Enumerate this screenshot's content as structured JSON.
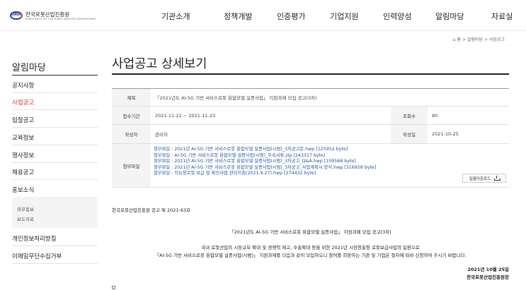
{
  "header": {
    "logo_text": "한국로봇산업진흥원",
    "logo_mark": "KIRIA",
    "logo_sub": "KOREA INSTITUTE FOR ROBOT INDUSTRY ADVANCEMENT",
    "nav": [
      "기관소개",
      "정책개발",
      "인증평가",
      "기업지원",
      "인력양성",
      "알림마당",
      "자료실"
    ]
  },
  "breadcrumb": {
    "home_icon": "home-icon",
    "home": "홈",
    "sep": ">",
    "level1": "알림마당",
    "level2": "사업공고"
  },
  "sidebar": {
    "title": "알림마당",
    "items": [
      {
        "label": "공지사항",
        "active": false
      },
      {
        "label": "사업공고",
        "active": true
      },
      {
        "label": "입찰공고",
        "active": false
      },
      {
        "label": "교육정보",
        "active": false
      },
      {
        "label": "행사정보",
        "active": false
      },
      {
        "label": "채용공고",
        "active": false
      },
      {
        "label": "홍보소식",
        "active": false
      }
    ],
    "subitems": [
      "외부홍보",
      "보도자료"
    ],
    "items_after": [
      "개인정보처리방침",
      "이메일무단수집거부"
    ]
  },
  "main": {
    "page_title": "사업공고 상세보기",
    "table": {
      "title_label": "제목",
      "title_value": "「2021년도 AI-5G 기반 서비스로봇 융합모델 실증사업」 지원과제 모집 공고(3차)",
      "period_label": "접수기간",
      "period_value": "2021-11-22 ~ 2021-11-23",
      "views_label": "조회수",
      "views_value": "80",
      "author_label": "작성자",
      "author_value": "관리자",
      "date_label": "작성일",
      "date_value": "2021-10-25",
      "files_label": "첨부파일",
      "files": [
        "첨부파일 : 2021년 AI-5G 기반 서비스로봇 융합모델 실증사업(시범)_3차공고문.hwp [125952 byte]",
        "첨부파일 : AI-5G 기반 서비스로봇 융합모델 실증사업(시범)_부속서류.zip [243317 byte]",
        "첨부파일 : 2021년 AI-5G 기반 서비스로봇 융합모델 실증사업(시범)_3차공고_Q&A.hwp [109568 byte]",
        "첨부파일 : 2021년 AI-5G 기반 서비스로봇 융합모델 실증사업(시범)_3차공고_사업계획서 양식.hwp [316928 byte]",
        "첨부파일 : 지능형로봇 보급 및 확산사업 관리지침(2021.9.27).hwp [274432 byte]"
      ],
      "download_all": "일괄다운로드"
    },
    "notice_no": "한국로봇산업진흥원 공고 제 2021-63호",
    "notice_title": "「2021년도 AI-5G 기반 서비스로봇 융합모델 실증사업」 지원과제 모집 공고(3차)",
    "paragraph_line1": "국내 로봇산업의 시장규모 확대 및 경쟁력 제고, 수출확대 등을 위한 2021년 시장창출형 로봇보급사업의 일환으로",
    "paragraph_line2": "「AI-5G 기반 서비스로봇 융합모델 실증사업(시범)」 지원과제를 다음과 같이 모집하오니 참여를 희망하는 기관 및 기업은 절차에 따라 신청하여 주시기 바랍니다.",
    "date": "2021년 10월 25일",
    "org": "한국로봇산업진흥원장"
  },
  "colors": {
    "accent": "#d9342b",
    "link": "#1f4f9f",
    "brand": "#1f3f8f"
  }
}
